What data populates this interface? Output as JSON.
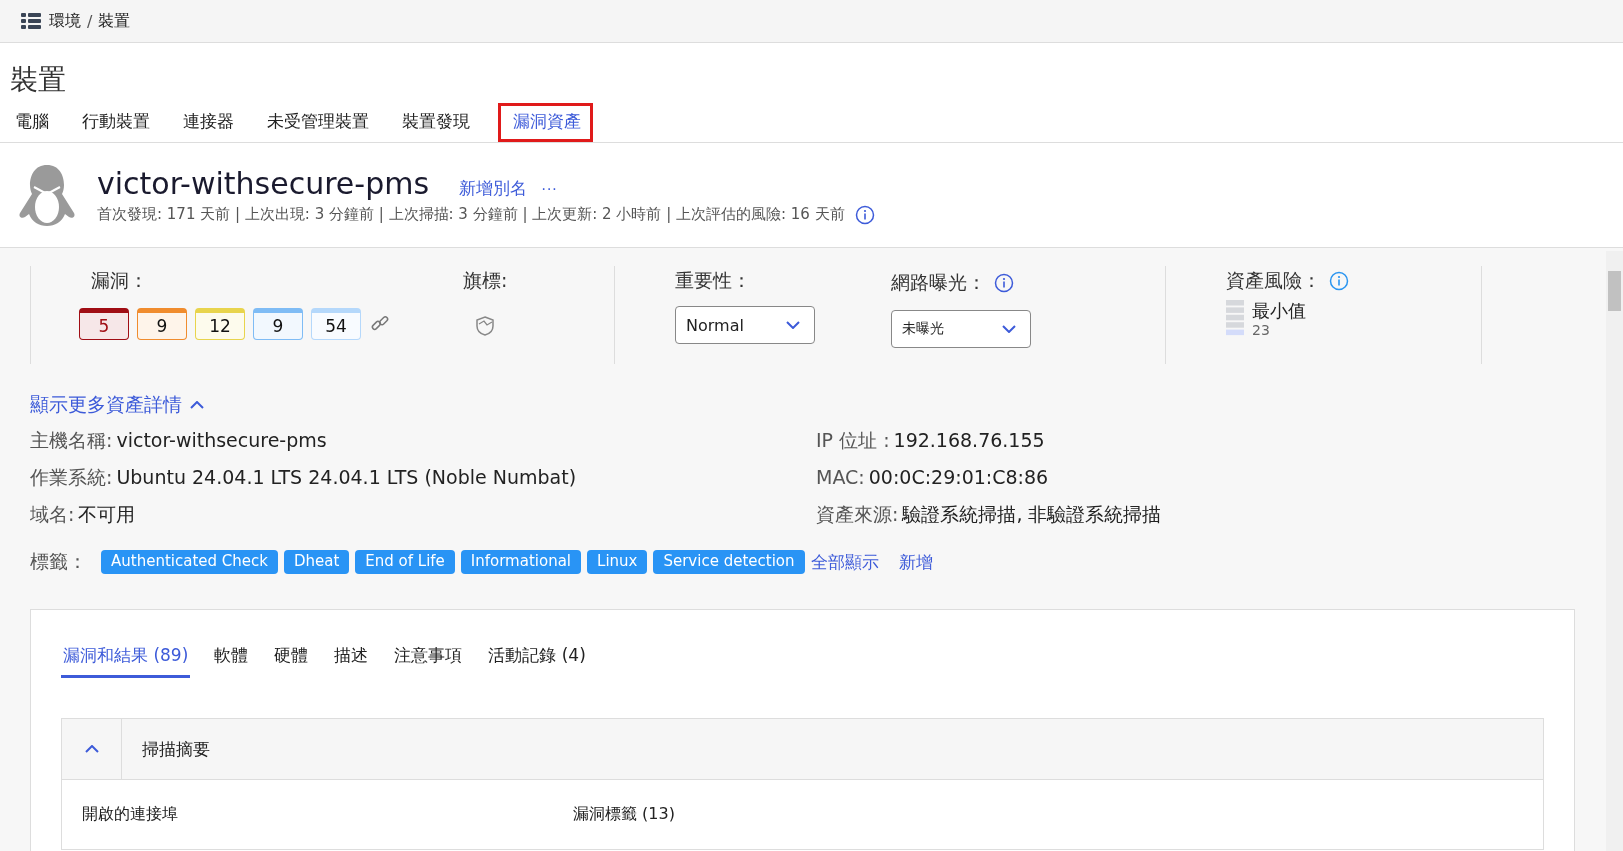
{
  "breadcrumb": {
    "items": [
      "環境",
      "裝置"
    ],
    "separator": "/"
  },
  "page_title": "裝置",
  "tabs": [
    {
      "label": "電腦",
      "selected": false,
      "highlighted": false
    },
    {
      "label": "行動裝置",
      "selected": false,
      "highlighted": false
    },
    {
      "label": "連接器",
      "selected": false,
      "highlighted": false
    },
    {
      "label": "未受管理裝置",
      "selected": false,
      "highlighted": false
    },
    {
      "label": "裝置發現",
      "selected": false,
      "highlighted": false
    },
    {
      "label": "漏洞資產",
      "selected": true,
      "highlighted": true
    }
  ],
  "asset": {
    "name": "victor-withsecure-pms",
    "add_alias": "新增別名",
    "more": "···",
    "meta": "首次發現: 171 天前 | 上次出現: 3 分鐘前 | 上次掃描: 3 分鐘前 | 上次更新: 2 小時前 | 上次評估的風險: 16 天前"
  },
  "summary": {
    "vulnerabilities_label": "漏洞：",
    "vulnerabilities": [
      {
        "count": "5",
        "color": "#a00d14"
      },
      {
        "count": "9",
        "color": "#f08c2e"
      },
      {
        "count": "12",
        "color": "#e8d44d"
      },
      {
        "count": "9",
        "color": "#7fbcf5"
      },
      {
        "count": "54",
        "color": "#b5d8fb"
      }
    ],
    "flags_label": "旗標:",
    "importance_label": "重要性：",
    "importance_value": "Normal",
    "exposure_label": "網路曝光：",
    "exposure_value": "未曝光",
    "risk_label": "資產風險：",
    "risk_level_text": "最小值",
    "risk_score": "23",
    "level": 0.2
  },
  "details": {
    "toggle": "顯示更多資產詳情",
    "fields": [
      {
        "label": "主機名稱:",
        "value": "victor-withsecure-pms"
      },
      {
        "label": "IP 位址 :",
        "value": "192.168.76.155"
      },
      {
        "label": "作業系統:",
        "value": "Ubuntu 24.04.1 LTS 24.04.1 LTS (Noble Numbat)"
      },
      {
        "label": "MAC:",
        "value": "00:0C:29:01:C8:86"
      },
      {
        "label": "域名:",
        "value": "不可用"
      },
      {
        "label": "資產來源:",
        "value": "驗證系統掃描, 非驗證系統掃描"
      }
    ],
    "tags_label": "標籤：",
    "tags": [
      "Authenticated Check",
      "Dheat",
      "End of Life",
      "Informational",
      "Linux",
      "Service detection"
    ],
    "show_all": "全部顯示",
    "add": "新增"
  },
  "inner_tabs": [
    {
      "label": "漏洞和結果 (89)",
      "selected": true
    },
    {
      "label": "軟體",
      "selected": false
    },
    {
      "label": "硬體",
      "selected": false
    },
    {
      "label": "描述",
      "selected": false
    },
    {
      "label": "注意事項",
      "selected": false
    },
    {
      "label": "活動記錄 (4)",
      "selected": false
    }
  ],
  "scan_summary": {
    "title": "掃描摘要",
    "expanded": true,
    "column_1": "開啟的連接埠",
    "column_2": "漏洞標籤 (13)"
  }
}
